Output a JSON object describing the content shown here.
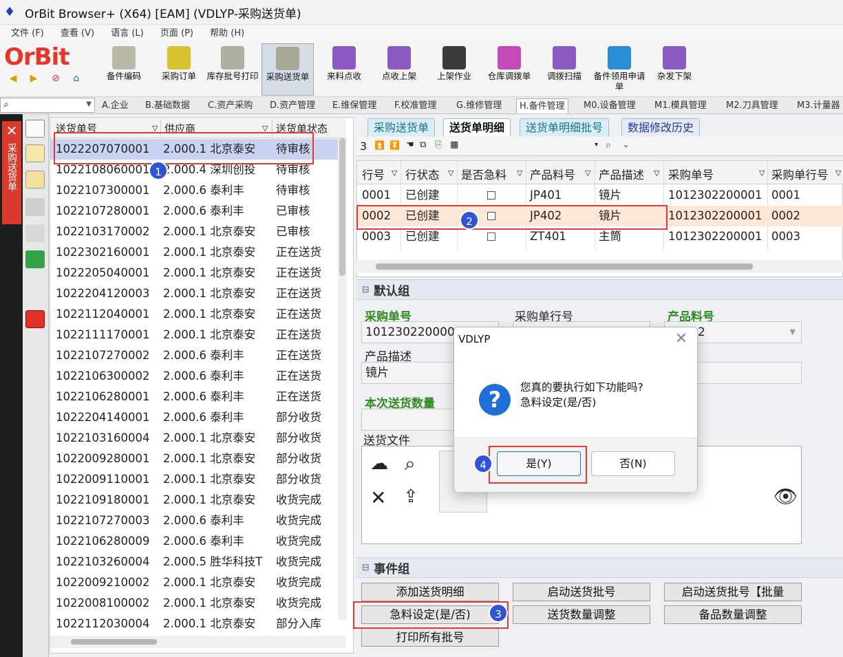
{
  "window": {
    "title": "OrBit Browser+ (X64) [EAM] (VDLYP-采购送货单)"
  },
  "menu": [
    "文件 (F)",
    "查看 (V)",
    "语言 (L)",
    "页面 (P)",
    "帮助 (H)"
  ],
  "brand": "OrBit",
  "toolbar": [
    {
      "label": "备件编码"
    },
    {
      "label": "采购订单"
    },
    {
      "label": "库存批号打印"
    },
    {
      "label": "采购送货单"
    },
    {
      "label": "来料点收"
    },
    {
      "label": "点收上架"
    },
    {
      "label": "上架作业"
    },
    {
      "label": "仓库调拨单"
    },
    {
      "label": "调拨扫描"
    },
    {
      "label": "备件领用申请单"
    },
    {
      "label": "杂发下架"
    }
  ],
  "modules": [
    "A.企业",
    "B.基础数据",
    "C.资产采购",
    "D.资产管理",
    "E.维保管理",
    "F.校准管理",
    "G.维修管理",
    "H.备件管理",
    "M0.设备管理",
    "M1.模具管理",
    "M2.刀具管理",
    "M3.计量器"
  ],
  "side_tab": "采购送货单",
  "left_grid": {
    "headers": [
      "送货单号",
      "供应商",
      "送货单状态"
    ],
    "rows": [
      [
        "1022207070001",
        "2.000.1 北京泰安",
        "待审核"
      ],
      [
        "1022108060001",
        "2.000.4 深圳创投",
        "待审核"
      ],
      [
        "1022107300001",
        "2.000.6 泰利丰",
        "待审核"
      ],
      [
        "1022107280001",
        "2.000.6 泰利丰",
        "已审核"
      ],
      [
        "1022103170002",
        "2.000.1 北京泰安",
        "已审核"
      ],
      [
        "1022302160001",
        "2.000.1 北京泰安",
        "正在送货"
      ],
      [
        "1022205040001",
        "2.000.1 北京泰安",
        "正在送货"
      ],
      [
        "1022204120003",
        "2.000.1 北京泰安",
        "正在送货"
      ],
      [
        "1022112040001",
        "2.000.1 北京泰安",
        "正在送货"
      ],
      [
        "1022111170001",
        "2.000.1 北京泰安",
        "正在送货"
      ],
      [
        "1022107270002",
        "2.000.6 泰利丰",
        "正在送货"
      ],
      [
        "1022106300002",
        "2.000.6 泰利丰",
        "正在送货"
      ],
      [
        "1022106280001",
        "2.000.6 泰利丰",
        "正在送货"
      ],
      [
        "1022204140001",
        "2.000.6 泰利丰",
        "部分收货"
      ],
      [
        "1022103160004",
        "2.000.1 北京泰安",
        "部分收货"
      ],
      [
        "1022009280001",
        "2.000.1 北京泰安",
        "部分收货"
      ],
      [
        "1022009110001",
        "2.000.1 北京泰安",
        "部分收货"
      ],
      [
        "1022109180001",
        "2.000.1 北京泰安",
        "收货完成"
      ],
      [
        "1022107270003",
        "2.000.6 泰利丰",
        "收货完成"
      ],
      [
        "1022106280009",
        "2.000.6 泰利丰",
        "收货完成"
      ],
      [
        "1022103260004",
        "2.000.5 胜华科技T",
        "收货完成"
      ],
      [
        "1022009210002",
        "2.000.1 北京泰安",
        "收货完成"
      ],
      [
        "1022008100002",
        "2.000.1 北京泰安",
        "收货完成"
      ],
      [
        "1022112030004",
        "2.000.1 北京泰安",
        "部分入库"
      ]
    ]
  },
  "right_tabs": [
    "采购送货单",
    "送货单明细",
    "送货单明细批号",
    "数据修改历史"
  ],
  "record_count": "3",
  "detail_grid": {
    "headers": [
      "行号",
      "行状态",
      "是否急料",
      "产品料号",
      "产品描述",
      "采购单号",
      "采购单行号"
    ],
    "rows": [
      [
        "0001",
        "已创建",
        "",
        "JP401",
        "镜片",
        "1012302200001",
        "0001"
      ],
      [
        "0002",
        "已创建",
        "",
        "JP402",
        "镜片",
        "1012302200001",
        "0002"
      ],
      [
        "0003",
        "已创建",
        "",
        "ZT401",
        "主筒",
        "1012302200001",
        "0003"
      ]
    ]
  },
  "default_group": {
    "title": "默认组",
    "po_label": "采购单号",
    "po_value": "101230220000",
    "po_line_label": "采购单行号",
    "part_label": "产品料号",
    "part_value": "2",
    "desc_label": "产品描述",
    "desc_value": "镜片",
    "qty_label": "本次送货数量",
    "file_label": "送货文件"
  },
  "event_group": {
    "title": "事件组",
    "buttons": [
      "添加送货明细",
      "启动送货批号",
      "启动送货批号【批量",
      "急料设定(是/否)",
      "送货数量调整",
      "备品数量调整",
      "打印所有批号"
    ]
  },
  "dialog": {
    "title": "VDLYP",
    "line1": "您真的要执行如下功能吗?",
    "line2": "急料设定(是/否)",
    "yes": "是(Y)",
    "no": "否(N)"
  },
  "annotations": [
    "1",
    "2",
    "3",
    "4"
  ],
  "colors": {
    "accent_red": "#e53935",
    "badge_blue": "#2f55d4",
    "group_green": "#2e8b1e"
  }
}
